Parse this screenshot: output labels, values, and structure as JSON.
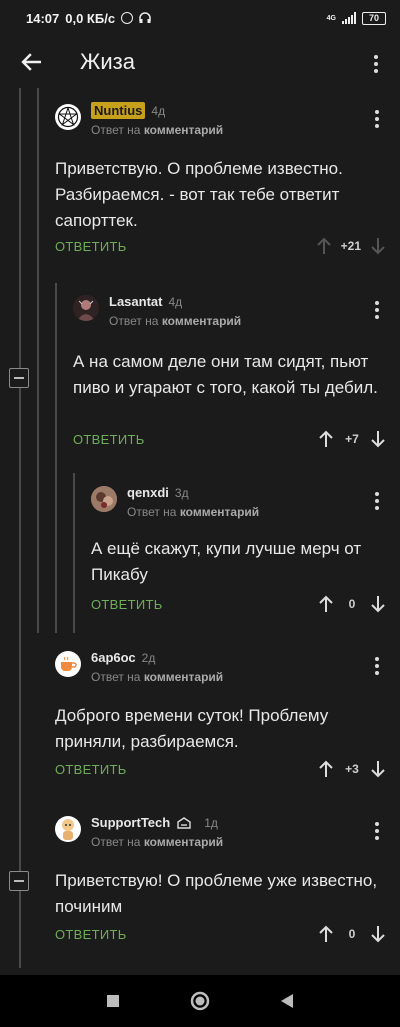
{
  "status": {
    "time": "14:07",
    "speed": "0,0 КБ/с",
    "network": "4G",
    "battery": "70"
  },
  "appbar": {
    "title": "Жиза"
  },
  "comments": [
    {
      "author": "Nuntius",
      "time": "4д",
      "reply_prefix": "Ответ на",
      "reply_target": "комментарий",
      "text": "Приветствую. О проблеме известно. Разбираемся. - вот так тебе ответит сапорттек.",
      "reply_label": "ОТВЕТИТЬ",
      "rating": "+21"
    },
    {
      "author": "Lasantat",
      "time": "4д",
      "reply_prefix": "Ответ на",
      "reply_target": "комментарий",
      "text": "А на самом деле они там сидят, пьют пиво и угарают с того, какой ты дебил.",
      "reply_label": "ОТВЕТИТЬ",
      "rating": "+7"
    },
    {
      "author": "qenxdi",
      "time": "3д",
      "reply_prefix": "Ответ на",
      "reply_target": "комментарий",
      "text": "А ещё скажут, купи лучше мерч от Пикабу",
      "reply_label": "ОТВЕТИТЬ",
      "rating": "0"
    },
    {
      "author": "6ар6ос",
      "time": "2д",
      "reply_prefix": "Ответ на",
      "reply_target": "комментарий",
      "text": "Доброго времени суток! Проблему приняли, разбираемся.",
      "reply_label": "ОТВЕТИТЬ",
      "rating": "+3"
    },
    {
      "author": "SupportTech",
      "time": "1д",
      "reply_prefix": "Ответ на",
      "reply_target": "комментарий",
      "text": "Приветствую! О проблеме уже известно, починим",
      "reply_label": "ОТВЕТИТЬ",
      "rating": "0"
    }
  ]
}
